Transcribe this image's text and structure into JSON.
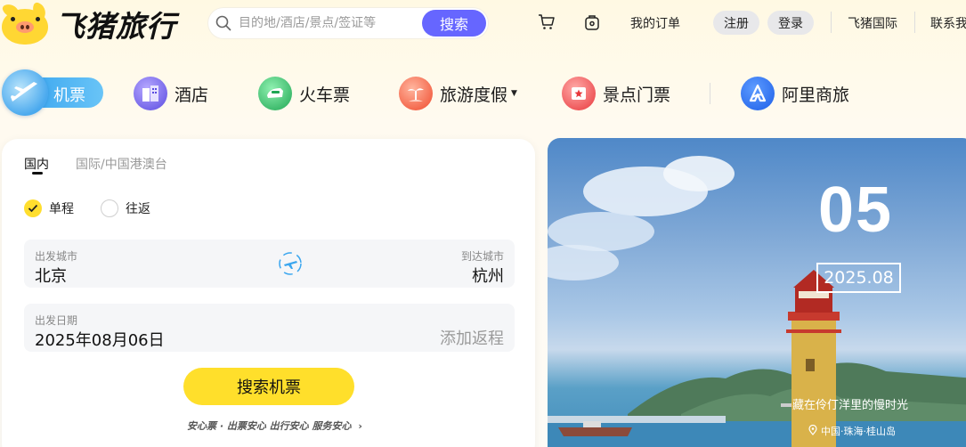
{
  "header": {
    "logo_text": "飞猪旅行",
    "search_placeholder": "目的地/酒店/景点/签证等",
    "search_button": "搜索",
    "my_orders": "我的订单",
    "register": "注册",
    "login": "登录",
    "international": "飞猪国际",
    "contact": "联系我"
  },
  "nav": {
    "items": [
      {
        "label": "机票",
        "icon": "plane-icon",
        "active": true
      },
      {
        "label": "酒店",
        "icon": "hotel-icon"
      },
      {
        "label": "火车票",
        "icon": "train-icon"
      },
      {
        "label": "旅游度假",
        "icon": "beach-icon",
        "has_dropdown": true
      },
      {
        "label": "景点门票",
        "icon": "ticket-icon"
      },
      {
        "label": "阿里商旅",
        "icon": "alibaba-business-icon"
      }
    ]
  },
  "flight": {
    "tabs": [
      "国内",
      "国际/中国港澳台"
    ],
    "trip_types": [
      "单程",
      "往返"
    ],
    "selected_trip": "单程",
    "from_label": "出发城市",
    "from_value": "北京",
    "to_label": "到达城市",
    "to_value": "杭州",
    "date_label": "出发日期",
    "date_value": "2025年08月06日",
    "add_return": "添加返程",
    "submit": "搜索机票",
    "assurance": "安心票 · 出票安心 出行安心 服务安心"
  },
  "banner": {
    "day": "05",
    "month": "2025.08",
    "caption": "藏在伶仃洋里的慢时光",
    "location": "中国·珠海·桂山岛"
  },
  "colors": {
    "accent_yellow": "#ffdf2b",
    "search_button": "#6666ff",
    "active_nav": "#3aa6ef"
  }
}
